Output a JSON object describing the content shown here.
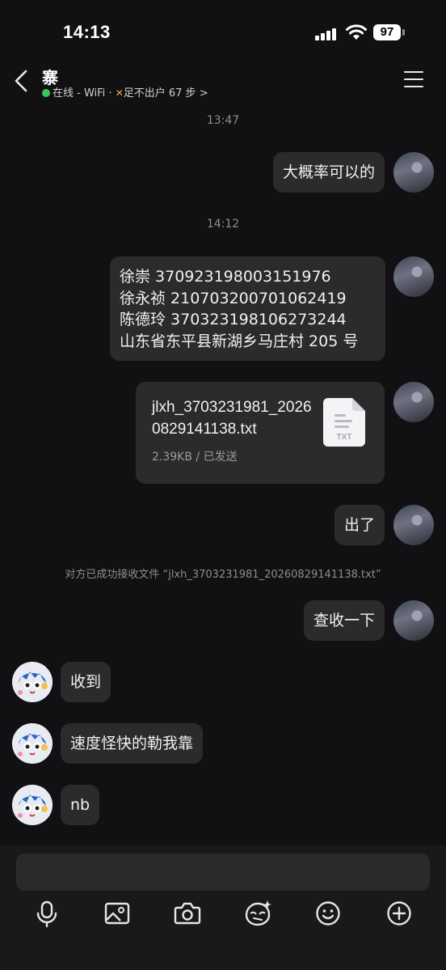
{
  "status_bar": {
    "time": "14:13",
    "battery": "97"
  },
  "header": {
    "title": "寨",
    "presence": "在线 - WiFi · ",
    "steps": "足不出户 67 步 >"
  },
  "messages": {
    "ts1": "13:47",
    "m1": "大概率可以的",
    "ts2": "14:12",
    "m2_lines": [
      "徐崇 370923198003151976",
      "徐永祯 210703200701062419",
      "陈德玲 370323198106273244",
      "山东省东平县新湖乡马庄村 205 号"
    ],
    "file": {
      "name": "jlxh_3703231981_20260829141138.txt",
      "meta": "2.39KB / 已发送",
      "icon_label": "TXT"
    },
    "m3": "出了",
    "system_note": "对方已成功接收文件 “jlxh_3703231981_20260829141138.txt”",
    "m4": "查收一下",
    "r1": "收到",
    "r2": "速度怪快的勒我靠",
    "r3": "nb"
  },
  "toolbar": {
    "icons": [
      "microphone-icon",
      "image-icon",
      "camera-icon",
      "sticker-icon",
      "emoji-icon",
      "plus-icon"
    ]
  },
  "colors": {
    "background": "#111113",
    "bubble": "#2b2b2e",
    "online": "#35c95a"
  }
}
